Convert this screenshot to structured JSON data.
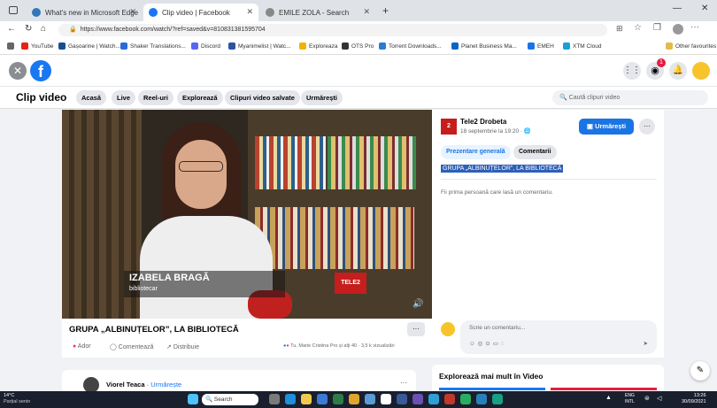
{
  "browser": {
    "tabs": [
      {
        "label": "What's new in Microsoft Edge",
        "color": "#3277bc"
      },
      {
        "label": "Clip video | Facebook",
        "color": "#1877f2"
      },
      {
        "label": "EMILE ZOLA - Search",
        "color": "#888888"
      }
    ],
    "new_tab": "+",
    "url": "https://www.facebook.com/watch/?ref=saved&v=810831381595704",
    "favorites": [
      "YouTube",
      "Gașoarine | Watch...",
      "Shaker Translations...",
      "Discord",
      "Myanimelist | Watc...",
      "Exploreaza",
      "OTS Pro",
      "Torrent Downloads...",
      "Planet Business Ma...",
      "EMEH",
      "XTM Cloud"
    ],
    "other_favorites": "Other favourites"
  },
  "fb": {
    "section_title": "Clip video",
    "nav": [
      "Acasă",
      "Live",
      "Reel-uri",
      "Explorează",
      "Clipuri video salvate",
      "Urmărești"
    ],
    "search_placeholder": "Caută clipuri video",
    "notification_count": "1"
  },
  "video": {
    "lower_third_name": "IZABELA BRAGĂ",
    "lower_third_role": "bibliotecar",
    "channel_logo": "TELE2"
  },
  "post": {
    "page_name": "Tele2 Drobeta",
    "date": "18 septembrie la 19:20 · ",
    "follow_label": "Urmărești",
    "more": "···",
    "tab_overview": "Prezentare generală",
    "tab_comments": "Comentarii",
    "description": "GRUPA „ALBINUȚELOR”, LA BIBLIOTECĂ",
    "first_comment_prompt": "Fii prima persoană care lasă un comentariu.",
    "comment_placeholder": "Scrie un comentariu..."
  },
  "below_video": {
    "title": "GRUPA „ALBINUȚELOR”, LA BIBLIOTECĂ",
    "more": "···",
    "like": "Ador",
    "comment": "Comentează",
    "share": "Distribuie",
    "reactions_text": "Tu, Marie Cristina Pro și alți 40 · 3,5 k vizualizări"
  },
  "next": {
    "author": "Viorel Teaca",
    "follow": "Urmărește",
    "more": "···"
  },
  "explore": {
    "title": "Explorează mai mult în Video"
  },
  "taskbar": {
    "weather_temp": "14°C",
    "weather_desc": "Parțial senin",
    "search": "Search",
    "lang": "ENG",
    "lang2": "INTL",
    "time": "13:26",
    "date": "30/09/2021"
  }
}
